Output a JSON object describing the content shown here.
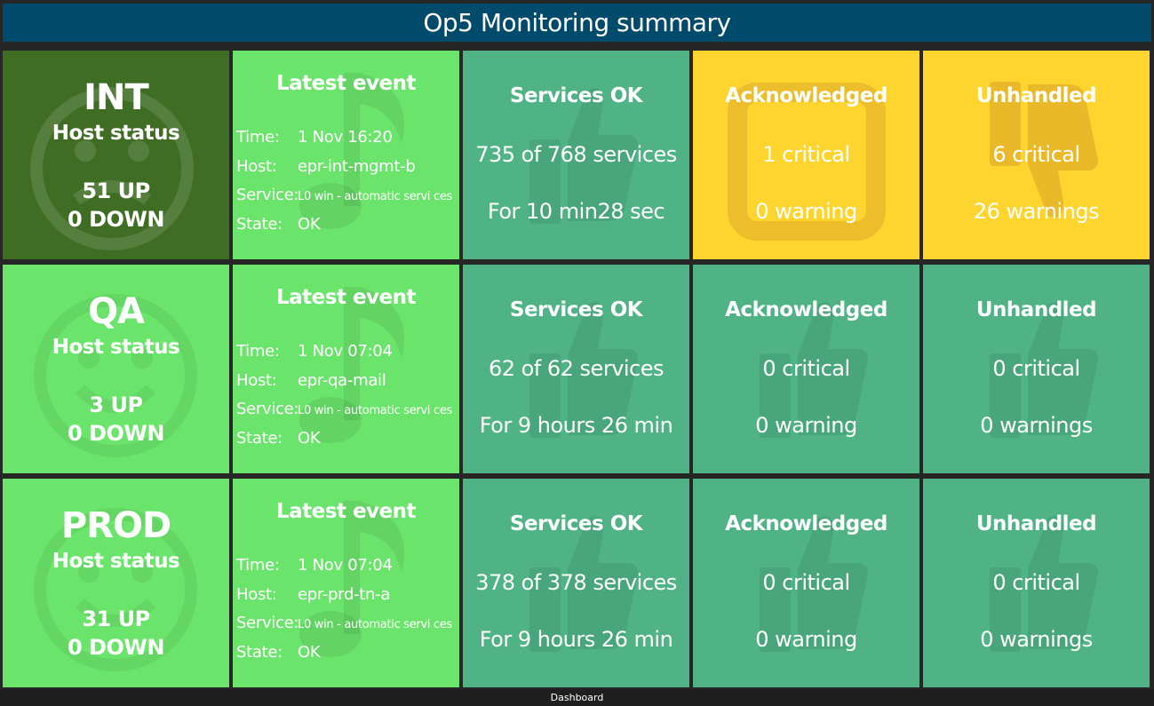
{
  "header": {
    "title": "Op5 Monitoring summary"
  },
  "rows": [
    {
      "host": {
        "name": "INT",
        "subtitle": "Host status",
        "up": "51 UP",
        "down": "0 DOWN"
      },
      "event": {
        "title": "Latest event",
        "time_label": "Time:",
        "time": "1 Nov 16:20",
        "host_label": "Host:",
        "host": "epr-int-mgmt-b",
        "service_label": "Service:",
        "service": "L0 win - automatic servi ces",
        "state_label": "State:",
        "state": "OK"
      },
      "services": {
        "title": "Services OK",
        "line1": "735 of 768 services",
        "line2": "For 10 min28 sec"
      },
      "acknowledged": {
        "title": "Acknowledged",
        "line1": "1 critical",
        "line2": "0 warning"
      },
      "unhandled": {
        "title": "Unhandled",
        "line1": "6 critical",
        "line2": "26 warnings"
      }
    },
    {
      "host": {
        "name": "QA",
        "subtitle": "Host status",
        "up": "3 UP",
        "down": "0 DOWN"
      },
      "event": {
        "title": "Latest event",
        "time_label": "Time:",
        "time": "1 Nov 07:04",
        "host_label": "Host:",
        "host": "epr-qa-mail",
        "service_label": "Service:",
        "service": "L0 win - automatic servi ces",
        "state_label": "State:",
        "state": "OK"
      },
      "services": {
        "title": "Services OK",
        "line1": "62 of 62 services",
        "line2": "For 9 hours 26 min"
      },
      "acknowledged": {
        "title": "Acknowledged",
        "line1": "0 critical",
        "line2": "0 warning"
      },
      "unhandled": {
        "title": "Unhandled",
        "line1": "0 critical",
        "line2": "0 warnings"
      }
    },
    {
      "host": {
        "name": "PROD",
        "subtitle": "Host status",
        "up": "31 UP",
        "down": "0 DOWN"
      },
      "event": {
        "title": "Latest event",
        "time_label": "Time:",
        "time": "1 Nov 07:04",
        "host_label": "Host:",
        "host": "epr-prd-tn-a",
        "service_label": "Service:",
        "service": "L0 win - automatic servi ces",
        "state_label": "State:",
        "state": "OK"
      },
      "services": {
        "title": "Services OK",
        "line1": "378 of 378 services",
        "line2": "For 9 hours 26 min"
      },
      "acknowledged": {
        "title": "Acknowledged",
        "line1": "0 critical",
        "line2": "0 warning"
      },
      "unhandled": {
        "title": "Unhandled",
        "line1": "0 critical",
        "line2": "0 warnings"
      }
    }
  ],
  "footer": {
    "label": "Dashboard"
  },
  "colors": {
    "header_bg": "#004a6b",
    "host_ok_green": "#6be46b",
    "host_warn_darkgreen": "#3f6d24",
    "services_ok_teal": "#4fb386",
    "warning_yellow": "#fed52e"
  },
  "icons": {
    "host": "smiley-icon",
    "event": "music-note-icon",
    "ok": "thumbs-up-icon",
    "acknowledged_warning": "square-frame-icon",
    "unhandled_warning": "thumbs-down-icon"
  }
}
